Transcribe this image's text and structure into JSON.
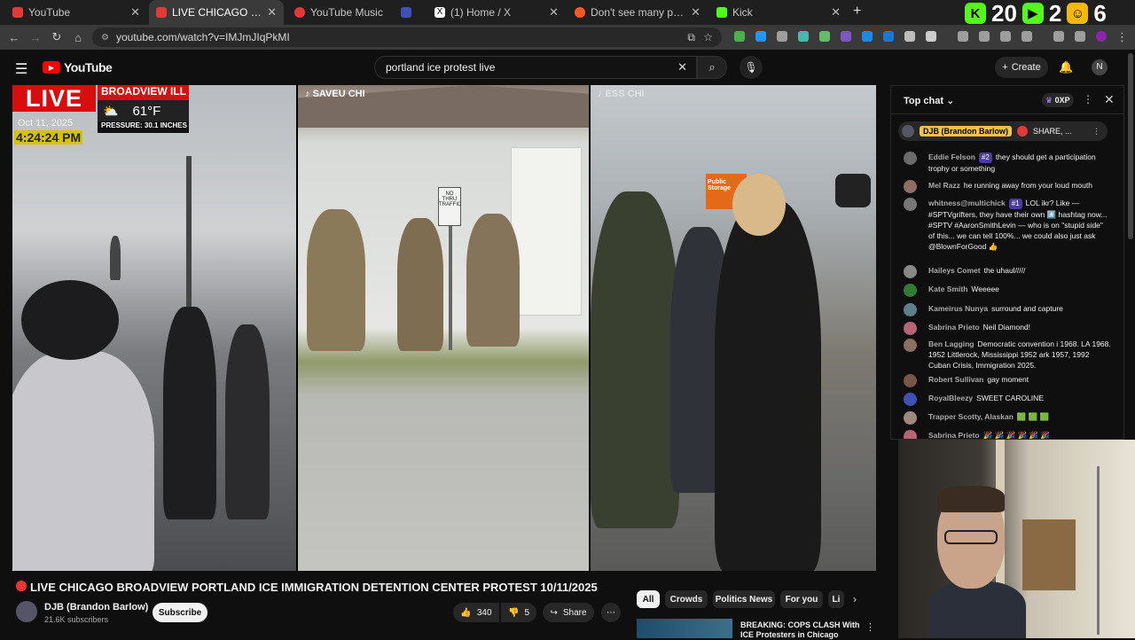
{
  "browser": {
    "tabs": [
      {
        "title": "YouTube",
        "color": "#e53935",
        "active": false
      },
      {
        "title": "LIVE CHICAGO BROADVIEW",
        "color": "#e53935",
        "active": true
      },
      {
        "title": "YouTube Music",
        "color": "#e53935",
        "active": false
      },
      {
        "title": "",
        "color": "#3f51b5",
        "active": false
      },
      {
        "title": "(1) Home / X",
        "color": "#ffffff",
        "active": false
      },
      {
        "title": "Don't see many people smoking",
        "color": "#ff5722",
        "active": false
      },
      {
        "title": "Kick",
        "color": "#53fc18",
        "active": false
      }
    ],
    "score": {
      "left": "20",
      "right": "2",
      "tail": "6"
    },
    "url": "youtube.com/watch?v=IMJmJIqPkMI"
  },
  "youtube": {
    "logo": "YouTube",
    "search_value": "portland ice protest live",
    "create_label": "Create",
    "avatar_letter": "N"
  },
  "video": {
    "overlay": {
      "live": "LIVE",
      "location": "BROADVIEW ILL",
      "temperature": "61°F",
      "pressure": "PRESSURE: 30.1 INCHES",
      "date": "Oct 11, 2025",
      "time": "4:24:24 PM"
    },
    "watermarks": [
      "SAVEU CHI",
      "ESS CHI"
    ],
    "sign_text": "NO THRU TRAFFIC",
    "store_sign": "Public Storage"
  },
  "meta": {
    "title": "LIVE CHICAGO BROADVIEW PORTLAND ICE IMMIGRATION DETENTION CENTER PROTEST 10/11/2025",
    "channel": "DJB (Brandon Barlow)",
    "subscribers": "21.6K subscribers",
    "subscribe_label": "Subscribe",
    "likes": "340",
    "dislikes": "5",
    "share_label": "Share"
  },
  "chips": [
    "All",
    "Crowds",
    "Politics News",
    "For you",
    "Li"
  ],
  "recommendation": {
    "title": "BREAKING: COPS CLASH With ICE Protesters in Chicago"
  },
  "chat": {
    "header": "Top chat",
    "points": "0XP",
    "pinned_author": "DJB (Brandon Barlow)",
    "pinned_text": "SHARE, ...",
    "messages": [
      {
        "author": "Eddie Felson",
        "badge": "#2",
        "text": "they should get a participation trophy or something",
        "color": "#6b6b6b"
      },
      {
        "author": "Mel Razz",
        "badge": "",
        "text": "he running away from your loud mouth",
        "color": "#8d6e63"
      },
      {
        "author": "whitness@multichick",
        "badge": "#1",
        "text": "LOL ikr? Like — #SPTVgrifters, they have their own #️⃣ hashtag now... #SPTV #AaronSmithLevin — who is on \"stupid side\" of this... we can tell 100%... we could also just ask @BlownForGood 👍",
        "color": "#777"
      },
      {
        "author": "Haileys Comet",
        "badge": "",
        "text": "the uhaul/////",
        "color": "#888"
      },
      {
        "author": "Kate Smith",
        "badge": "",
        "text": "Weeeee",
        "color": "#2e7d32"
      },
      {
        "author": "Kameirus Nunya",
        "badge": "",
        "text": "surround and capture",
        "color": "#607d8b"
      },
      {
        "author": "Sabrina Prieto",
        "badge": "",
        "text": "Neil Diamond!",
        "color": "#b56576"
      },
      {
        "author": "Ben Lagging",
        "badge": "",
        "text": "Democratic convention i 1968. LA 1968. 1952 Littlerock, Mississippi 1952 ark 1957, 1992 Cuban Crisis, Immigration 2025.",
        "color": "#8d6e63"
      },
      {
        "author": "Robert Sullivan",
        "badge": "",
        "text": "gay moment",
        "color": "#795548"
      },
      {
        "author": "RoyalBleezy",
        "badge": "",
        "text": "SWEET CAROLINE",
        "color": "#3f51b5"
      },
      {
        "author": "Trapper Scotty, Alaskan",
        "badge": "",
        "text": "🟩 🟩 🟩",
        "color": "#a1887f"
      },
      {
        "author": "Sabrina Prieto",
        "badge": "",
        "text": "🎉 🎉 🎉 🎉 🎉 🎉",
        "color": "#b56576"
      }
    ]
  }
}
